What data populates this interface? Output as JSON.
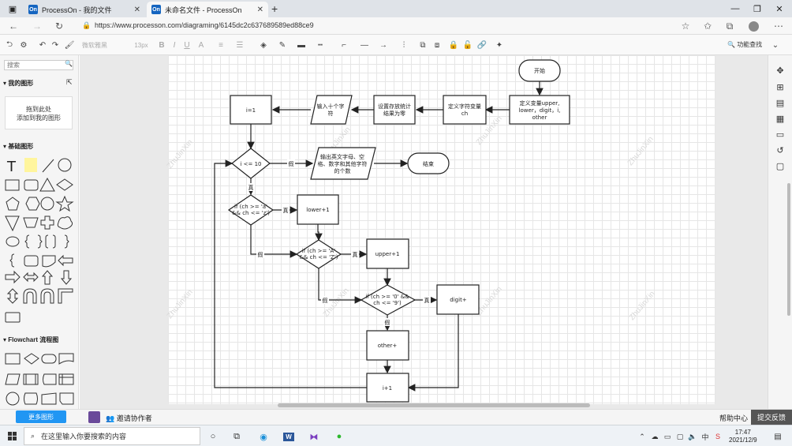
{
  "browser": {
    "tabs": [
      {
        "favicon": "On",
        "title": "ProcessOn - 我的文件",
        "active": false
      },
      {
        "favicon": "On",
        "title": "未命名文件 - ProcessOn",
        "active": true
      }
    ],
    "url": "https://www.processon.com/diagraming/6145dc2c637689589ed88ce9"
  },
  "toolbar": {
    "font_family": "微软雅黑",
    "font_size": "13px",
    "func_search": "功能查找"
  },
  "sidebar": {
    "search_placeholder": "搜索",
    "my_shapes_title": "我的图形",
    "drop_hint_line1": "拖到此处",
    "drop_hint_line2": "添加到我的图形",
    "basic_shapes_title": "基础图形",
    "flowchart_title": "Flowchart 流程图",
    "more_shapes": "更多图形"
  },
  "bottombar": {
    "invite": "邀请协作者",
    "help": "帮助中心",
    "feedback": "提交反馈"
  },
  "taskbar": {
    "search_placeholder": "在这里输入你要搜索的内容",
    "time": "17:47",
    "date": "2021/12/9"
  },
  "watermark": "ZhuJinXin",
  "flowchart": {
    "start": "开始",
    "define_vars": [
      "定义变量upper,",
      "lower，digit，i,",
      "other"
    ],
    "define_char": [
      "定义字符变量",
      "ch"
    ],
    "set_zero": [
      "设置存放统计",
      "结果为零"
    ],
    "input": [
      "输入十个字",
      "符"
    ],
    "i_init": "i=1",
    "cond_loop": "i <= 10",
    "output": [
      "输出英文字母、空",
      "格、数字和其他字符",
      "的个数"
    ],
    "end": "结束",
    "cond_lower": [
      "if (ch >= 'a'",
      "&& ch <= 'z')"
    ],
    "lower_inc": "lower+1",
    "cond_upper": [
      "if (ch >= 'A'",
      "&& ch <= 'Z')"
    ],
    "upper_inc": "upper+1",
    "cond_digit": [
      "if (ch >= '0' &&",
      "ch <= '9')"
    ],
    "digit_inc": "digit+",
    "other_inc": "other+",
    "i_inc": "i+1",
    "yes": "真",
    "no": "假"
  }
}
